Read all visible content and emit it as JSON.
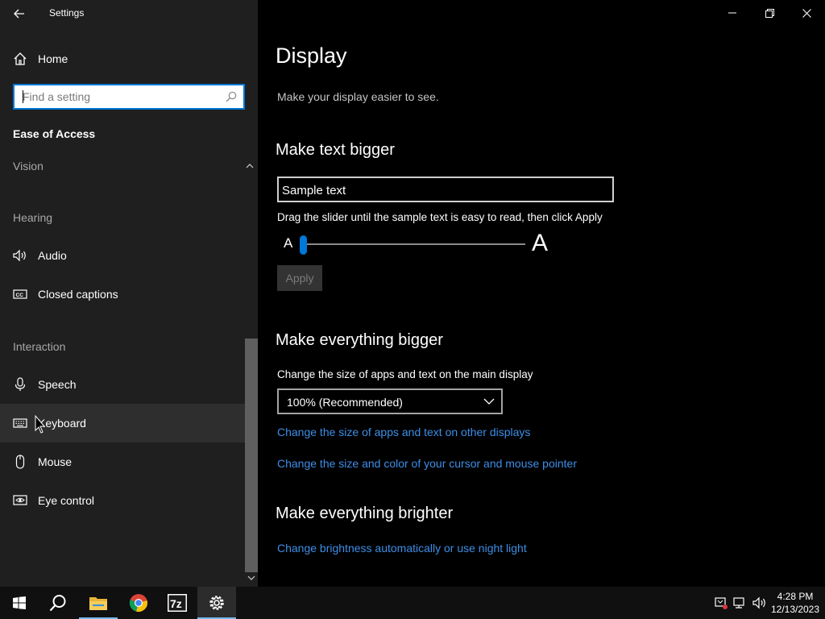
{
  "window": {
    "app_title": "Settings",
    "back_icon": "back-arrow-icon",
    "controls": [
      "minimize-icon",
      "restore-icon",
      "close-icon"
    ]
  },
  "sidebar": {
    "home_label": "Home",
    "search_placeholder": "Find a setting",
    "section_title": "Ease of Access",
    "groups": {
      "vision": "Vision",
      "hearing": "Hearing",
      "interaction": "Interaction"
    },
    "items": [
      {
        "label": "Audio",
        "icon": "speaker-icon"
      },
      {
        "label": "Closed captions",
        "icon": "closed-captions-icon"
      },
      {
        "label": "Speech",
        "icon": "microphone-icon"
      },
      {
        "label": "Keyboard",
        "icon": "keyboard-icon"
      },
      {
        "label": "Mouse",
        "icon": "mouse-icon"
      },
      {
        "label": "Eye control",
        "icon": "eye-control-icon"
      }
    ],
    "active_item": "Keyboard"
  },
  "main": {
    "title": "Display",
    "subtitle": "Make your display easier to see.",
    "text_bigger": {
      "heading": "Make text bigger",
      "sample_text": "Sample text",
      "instruction": "Drag the slider until the sample text is easy to read, then click Apply",
      "small_label": "A",
      "large_label": "A",
      "slider_value": 0,
      "apply_label": "Apply"
    },
    "everything_bigger": {
      "heading": "Make everything bigger",
      "label": "Change the size of apps and text on the main display",
      "selected": "100% (Recommended)",
      "link1": "Change the size of apps and text on other displays",
      "link2": "Change the size and color of your cursor and mouse pointer"
    },
    "everything_brighter": {
      "heading": "Make everything brighter",
      "link": "Change brightness automatically or use night light"
    }
  },
  "taskbar": {
    "apps": [
      "windows-start-icon",
      "search-icon",
      "file-explorer-icon",
      "chrome-icon",
      "7zip-icon",
      "settings-gear-icon"
    ],
    "time": "4:28 PM",
    "date": "12/13/2023",
    "accent": "#76b9ed"
  },
  "colors": {
    "accent": "#0078d7",
    "link": "#3d8ee6",
    "sidebar_bg": "#1f1f1f",
    "main_bg": "#000000"
  }
}
